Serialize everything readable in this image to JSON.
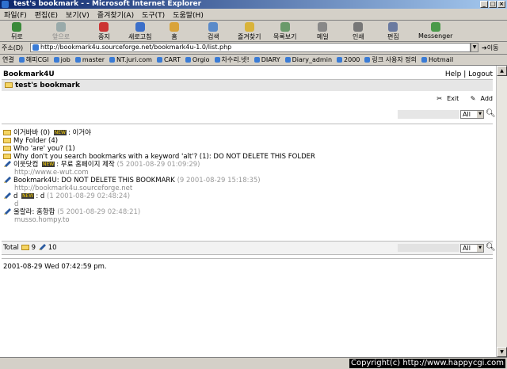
{
  "window": {
    "title": "test's bookmark - - Microsoft Internet Explorer"
  },
  "menu": [
    "파일(F)",
    "편집(E)",
    "보기(V)",
    "즐겨찾기(A)",
    "도구(T)",
    "도움말(H)"
  ],
  "toolbar": {
    "back": "뒤로",
    "forward": "앞으로",
    "stop": "중지",
    "refresh": "새로고침",
    "home": "홈",
    "search": "검색",
    "favorites": "즐겨찾기",
    "history": "목록보기",
    "mail": "메일",
    "print": "인쇄",
    "edit": "편집",
    "messenger": "Messenger"
  },
  "address": {
    "label": "주소(D)",
    "url": "http://bookmark4u.sourceforge.net/bookmark4u-1.0/list.php",
    "go": "이동"
  },
  "links": {
    "label": "연결",
    "items": [
      "해피CGI",
      "job",
      "master",
      "NT.juri.com",
      "CART",
      "Orgio",
      "차수리.넷!",
      "DIARY",
      "Diary_admin",
      "2000",
      "링크 사용자 정의",
      "Hotmail"
    ]
  },
  "page": {
    "brand": "Bookmark4U",
    "help": "Help",
    "sep": "|",
    "logout": "Logout",
    "folder_title": "test's bookmark",
    "exit": "Exit",
    "add": "Add",
    "search_select": "All",
    "folders": [
      {
        "name": "이거바바 (0)",
        "badge": "NEW",
        "desc": ": 이거야"
      },
      {
        "name": "My Folder (4)"
      },
      {
        "name": "Who 'are' you? (1)"
      },
      {
        "name": "Why don't you search bookmarks with a keyword 'alt'? (1): DO NOT DELETE THIS FOLDER"
      }
    ],
    "bookmarks": [
      {
        "title": "이웃닷컴",
        "badge": "NEW",
        "desc": ": 무료 홈페이지 제작",
        "meta": "(5 2001-08-29 01:09:29)",
        "url": "http://www.e-wut.com"
      },
      {
        "title": "Bookmark4U: DO NOT DELETE THIS BOOKMARK",
        "meta": "(9 2001-08-29 15:18:35)",
        "url": "http://bookmark4u.sourceforge.net"
      },
      {
        "title": "d",
        "badge": "NEW",
        "desc": ": d",
        "meta": "(1 2001-08-29 02:48:24)",
        "url": "d"
      },
      {
        "title": "울랄라: 홈항합",
        "meta": "(5 2001-08-29 02:48:21)",
        "url": "musso.hompy.to"
      }
    ],
    "total_label": "Total",
    "total_folders": "9",
    "total_bookmarks": "10",
    "datetime": "2001-08-29 Wed 07:42:59 pm."
  },
  "status": {
    "copyright": "Copyright(c) http://www.happycgi.com"
  }
}
